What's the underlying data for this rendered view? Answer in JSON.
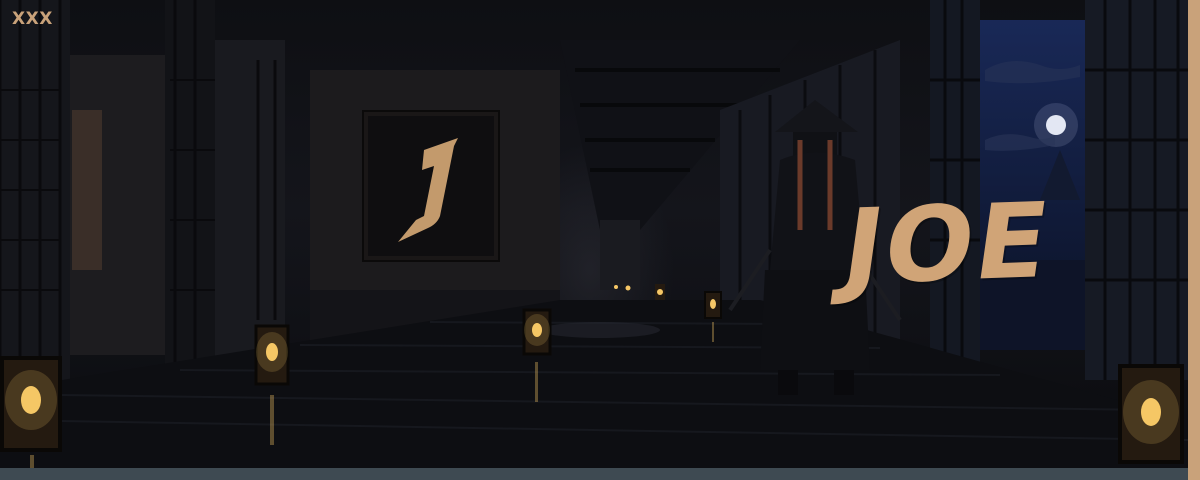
{
  "site": {
    "logo_text": "XXX"
  },
  "hero": {
    "title": "JOE",
    "emblem_letter": "J"
  },
  "colors": {
    "accent": "#c9a27a",
    "title": "#d0a477",
    "bottom_bar": "#3e4a52",
    "background": "#0e0f13",
    "moon": "#e8ecf4",
    "night_sky": "#0f1a3a"
  },
  "icons": {
    "logo": "xxx-logo-icon",
    "emblem": "calligraphy-j-emblem",
    "moon": "moon-icon",
    "lantern": "lantern-icon"
  }
}
